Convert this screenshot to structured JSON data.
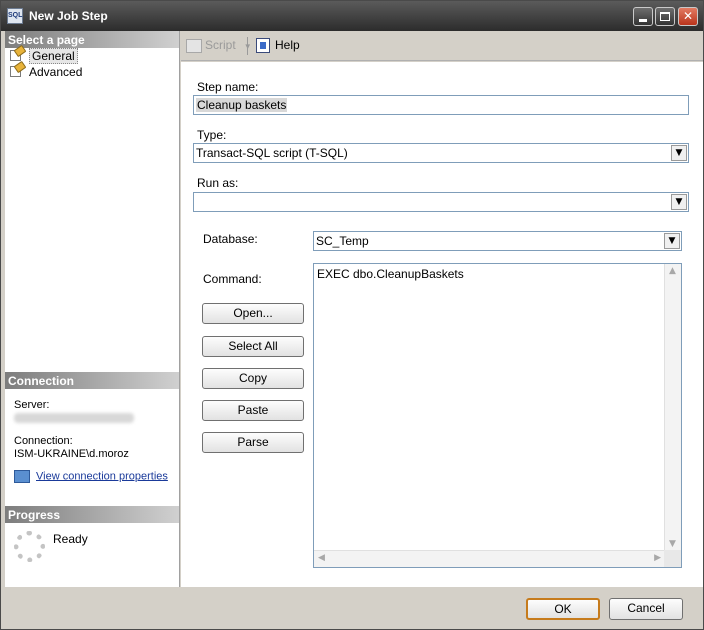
{
  "window": {
    "title": "New Job Step",
    "icon_text": "SQL"
  },
  "left_panel": {
    "select_page_header": "Select a page",
    "pages": [
      {
        "label": "General",
        "selected": true
      },
      {
        "label": "Advanced",
        "selected": false
      }
    ],
    "connection_header": "Connection",
    "server_label": "Server:",
    "connection_label": "Connection:",
    "connection_value": "ISM-UKRAINE\\d.moroz",
    "view_connection_link": "View connection properties",
    "progress_header": "Progress",
    "progress_status": "Ready"
  },
  "toolbar": {
    "script_label": "Script",
    "help_label": "Help"
  },
  "form": {
    "step_name_label": "Step name:",
    "step_name_value": "Cleanup baskets",
    "type_label": "Type:",
    "type_value": "Transact-SQL script (T-SQL)",
    "run_as_label": "Run as:",
    "run_as_value": "",
    "database_label": "Database:",
    "database_value": "SC_Temp",
    "command_label": "Command:",
    "command_value": "EXEC dbo.CleanupBaskets"
  },
  "command_buttons": {
    "open": "Open...",
    "select_all": "Select All",
    "copy": "Copy",
    "paste": "Paste",
    "parse": "Parse"
  },
  "dialog_buttons": {
    "ok": "OK",
    "cancel": "Cancel"
  },
  "colors": {
    "titlebar": "#3a3a3a",
    "link": "#1a3a9a",
    "ok_border": "#c67b1c"
  }
}
